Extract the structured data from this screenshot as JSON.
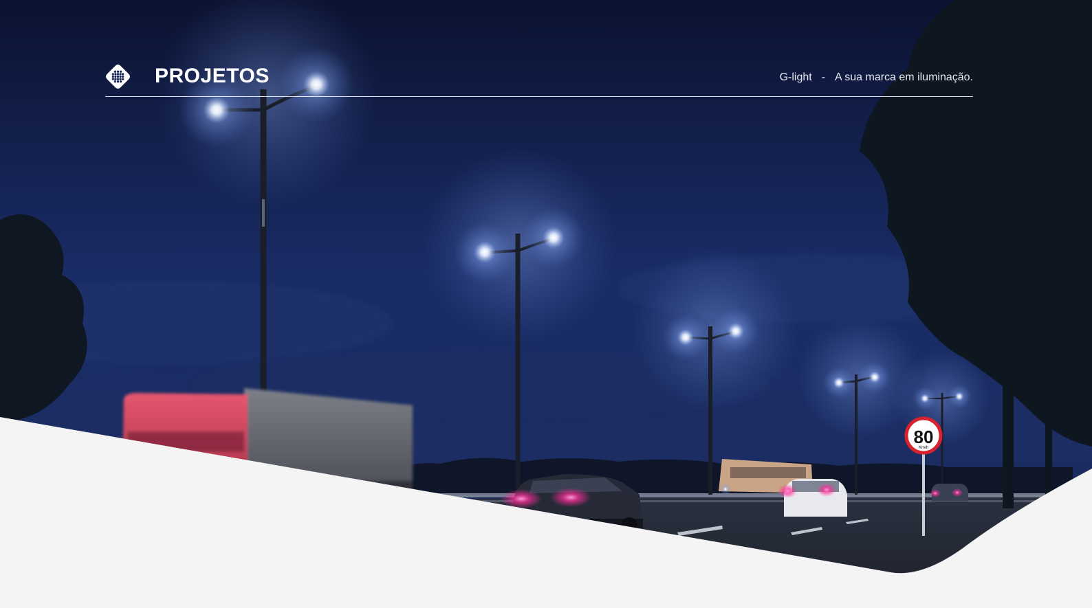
{
  "header": {
    "title": "PROJETOS",
    "brand": "G-light",
    "separator": "-",
    "slogan": "A sua marca em iluminação.",
    "logo_icon": "grid-dots-diamond-icon"
  },
  "photo": {
    "speed_sign_value": "80",
    "speed_sign_unit": "Km/h"
  },
  "colors": {
    "sky_top": "#0c1433",
    "sky_mid": "#1c2f6b",
    "wave_fill": "#f4f4f5",
    "text": "#ffffff"
  }
}
